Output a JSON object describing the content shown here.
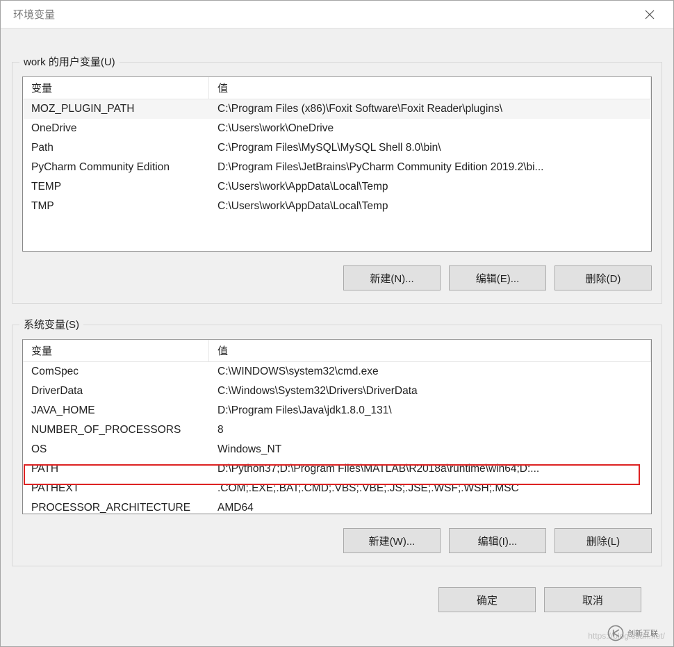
{
  "window": {
    "title": "环境变量"
  },
  "user_section": {
    "title": "work 的用户变量(U)",
    "headers": {
      "var": "变量",
      "val": "值"
    },
    "rows": [
      {
        "var": "MOZ_PLUGIN_PATH",
        "val": "C:\\Program Files (x86)\\Foxit Software\\Foxit Reader\\plugins\\"
      },
      {
        "var": "OneDrive",
        "val": "C:\\Users\\work\\OneDrive"
      },
      {
        "var": "Path",
        "val": "C:\\Program Files\\MySQL\\MySQL Shell 8.0\\bin\\"
      },
      {
        "var": "PyCharm Community Edition",
        "val": "D:\\Program Files\\JetBrains\\PyCharm Community Edition 2019.2\\bi..."
      },
      {
        "var": "TEMP",
        "val": "C:\\Users\\work\\AppData\\Local\\Temp"
      },
      {
        "var": "TMP",
        "val": "C:\\Users\\work\\AppData\\Local\\Temp"
      }
    ],
    "buttons": {
      "new": "新建(N)...",
      "edit": "编辑(E)...",
      "del": "删除(D)"
    }
  },
  "sys_section": {
    "title": "系统变量(S)",
    "headers": {
      "var": "变量",
      "val": "值"
    },
    "rows": [
      {
        "var": "ComSpec",
        "val": "C:\\WINDOWS\\system32\\cmd.exe"
      },
      {
        "var": "DriverData",
        "val": "C:\\Windows\\System32\\Drivers\\DriverData"
      },
      {
        "var": "JAVA_HOME",
        "val": "D:\\Program Files\\Java\\jdk1.8.0_131\\"
      },
      {
        "var": "NUMBER_OF_PROCESSORS",
        "val": "8"
      },
      {
        "var": "OS",
        "val": "Windows_NT"
      },
      {
        "var": "PATH",
        "val": "D:\\Python37;D:\\Program Files\\MATLAB\\R2018a\\runtime\\win64;D:..."
      },
      {
        "var": "PATHEXT",
        "val": ".COM;.EXE;.BAT;.CMD;.VBS;.VBE;.JS;.JSE;.WSF;.WSH;.MSC"
      },
      {
        "var": "PROCESSOR_ARCHITECTURE",
        "val": "AMD64"
      }
    ],
    "buttons": {
      "new": "新建(W)...",
      "edit": "编辑(I)...",
      "del": "删除(L)"
    }
  },
  "dialog": {
    "ok": "确定",
    "cancel": "取消"
  },
  "watermark": "https://blog.csdn.net/",
  "brand": "创新互联"
}
